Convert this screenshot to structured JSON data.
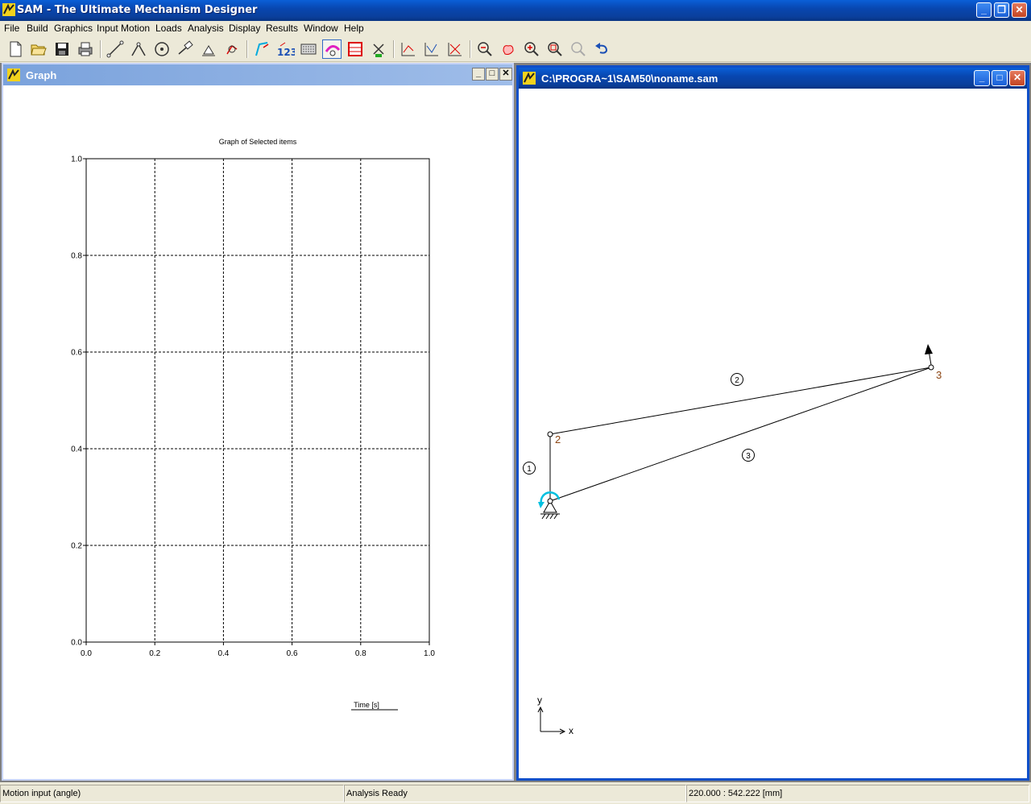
{
  "window": {
    "title": "SAM - The Ultimate Mechanism Designer"
  },
  "menu": [
    "File",
    "Build",
    "Graphics",
    "Input Motion",
    "Loads",
    "Analysis",
    "Display",
    "Results",
    "Window",
    "Help"
  ],
  "toolbar": {
    "icons": [
      "new-file-icon",
      "open-folder-icon",
      "save-disk-icon",
      "print-icon",
      "beam-element-icon",
      "truss-element-icon",
      "gear-element-icon",
      "slider-element-icon",
      "fixed-support-icon",
      "hinge-support-icon",
      "input-motion-icon",
      "numbering-123-icon",
      "calculator-icon",
      "analyse-icon",
      "results-table-icon",
      "animation-windmill-icon",
      "graph-xy-icon",
      "graph-xy2-icon",
      "graph-xy3-icon",
      "zoom-out-icon",
      "pan-hand-icon",
      "zoom-in-icon",
      "zoom-window-icon",
      "zoom-previous-icon",
      "undo-arrow-icon"
    ]
  },
  "graph_window": {
    "title": "Graph",
    "chart_data": {
      "type": "line",
      "title": "Graph of Selected items",
      "xlabel": "Time [s]",
      "ylabel": "",
      "xlim": [
        0.0,
        1.0
      ],
      "ylim": [
        0.0,
        1.0
      ],
      "xticks": [
        "0.0",
        "0.2",
        "0.4",
        "0.6",
        "0.8",
        "1.0"
      ],
      "yticks": [
        "0.0",
        "0.2",
        "0.4",
        "0.6",
        "0.8",
        "1.0"
      ],
      "grid": true,
      "series": []
    }
  },
  "mechanism_window": {
    "title": "C:\\PROGRA~1\\SAM50\\noname.sam",
    "nodes": [
      "2",
      "3"
    ],
    "elements": [
      "1",
      "2",
      "3"
    ],
    "axes": {
      "x": "x",
      "y": "y"
    },
    "colors": {
      "node_label": "#8b4513",
      "input_motion": "#00c0e0"
    }
  },
  "statusbar": {
    "left": "Motion input (angle)",
    "middle": "Analysis Ready",
    "right": "220.000 : 542.222 [mm]"
  }
}
